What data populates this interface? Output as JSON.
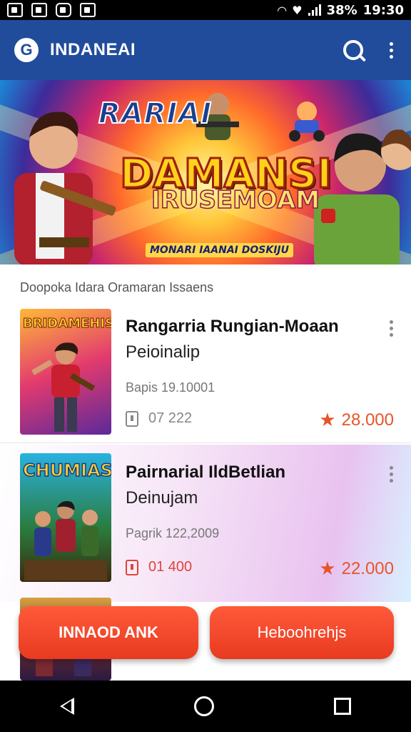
{
  "status_bar": {
    "battery": "38%",
    "time": "19:30",
    "icons": [
      "gallery-icon",
      "image-icon",
      "camera-icon",
      "shop-icon",
      "wifi-icon",
      "heart-icon",
      "signal-icon"
    ]
  },
  "app_bar": {
    "title": "INDANEAI",
    "logo_icon": "brand-g-icon",
    "search_icon": "search-icon",
    "menu_icon": "more-vert-icon",
    "color": "#214c9c"
  },
  "banner": {
    "title_line1": "RARIAI",
    "title_line2": "DAMANSI",
    "title_line3": "IRUSEMOAM",
    "tagline": "MONARI IAANAI DOSKIJU"
  },
  "section": {
    "label": "Doopoka Idara Oramaran Issaens"
  },
  "cards": [
    {
      "thumb_title": "BRIDAMEHIS",
      "title": "Rangarria Rungian-Moaan",
      "subtitle": "Peioinalip",
      "meta": "Bapis 19.10001",
      "tag": "07 222",
      "rating": "28.000"
    },
    {
      "thumb_title": "CHUMIAS",
      "title": "Pairnarial IldBetlian",
      "subtitle": "Deinujam",
      "meta": "Pagrik 122,2009",
      "tag": "01 400",
      "rating": "22.000"
    }
  ],
  "buttons": {
    "left_label": "INNAOD ANK",
    "right_label": "Heboohrehjs"
  },
  "colors": {
    "accent": "#e8542a",
    "button": "#f04a2a",
    "header": "#214c9c"
  },
  "nav_bar": {
    "back_icon": "back-triangle-icon",
    "home_icon": "home-circle-icon",
    "recent_icon": "recents-square-icon"
  }
}
